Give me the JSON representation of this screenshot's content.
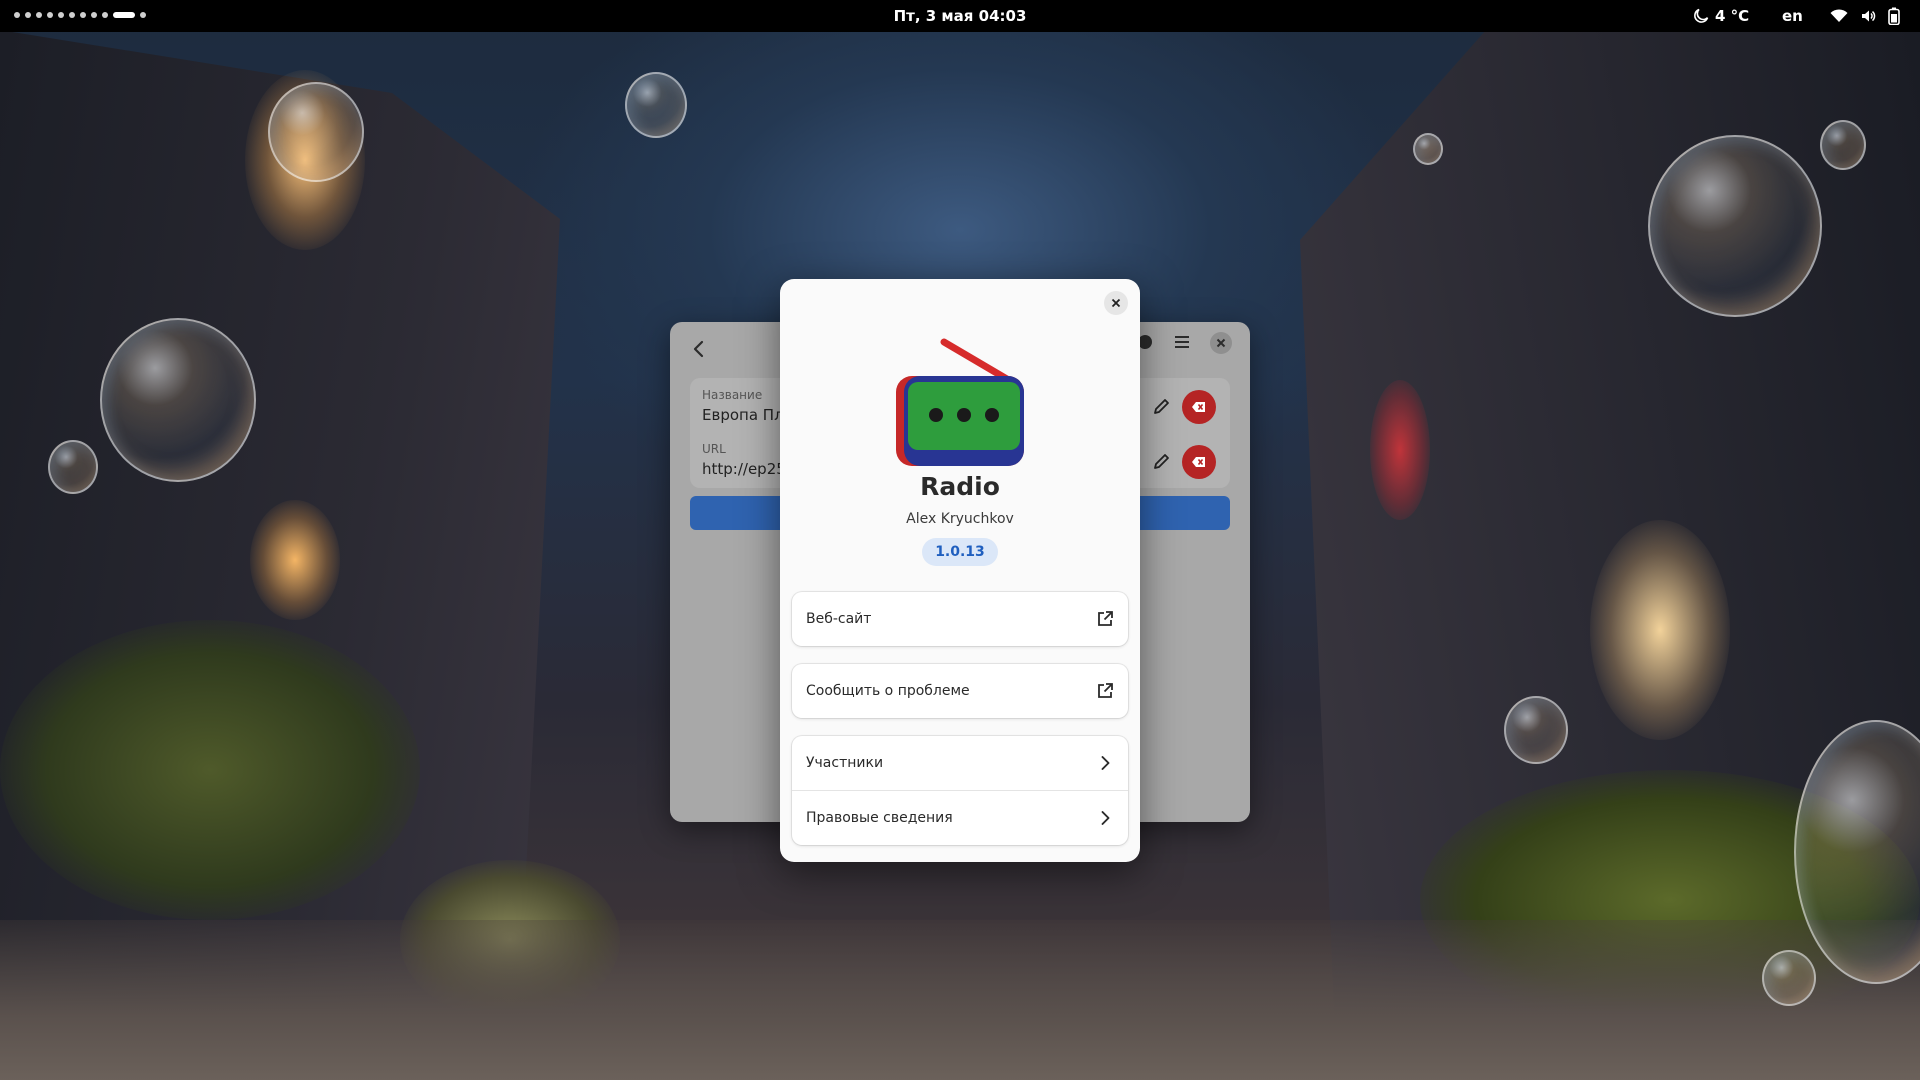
{
  "topbar": {
    "workspace_count": 11,
    "active_workspace": 10,
    "clock": "Пт, 3 мая  04:03",
    "weather_icon": "moon-icon",
    "temperature": "4 °C",
    "language": "en",
    "tray_icons": [
      "wifi-icon",
      "volume-icon",
      "battery-icon"
    ]
  },
  "background_window": {
    "fields": [
      {
        "label": "Название",
        "value": "Европа Плюс"
      },
      {
        "label": "URL",
        "value": "http://ep256"
      }
    ],
    "accent_color": "#2f63b0",
    "delete_color": "#b52424"
  },
  "about": {
    "app_name": "Radio",
    "author": "Alex Kryuchkov",
    "version": "1.0.13",
    "links": [
      {
        "label": "Веб-сайт",
        "icon": "external-link-icon"
      },
      {
        "label": "Сообщить о проблеме",
        "icon": "external-link-icon"
      }
    ],
    "pages": [
      {
        "label": "Участники",
        "icon": "chevron-right-icon"
      },
      {
        "label": "Правовые сведения",
        "icon": "chevron-right-icon"
      }
    ],
    "version_color": "#1f5fbf",
    "logo_colors": {
      "frame": "#283593",
      "side": "#c62828",
      "screen": "#2e9d3d",
      "antenna": "#d62b2b"
    }
  }
}
